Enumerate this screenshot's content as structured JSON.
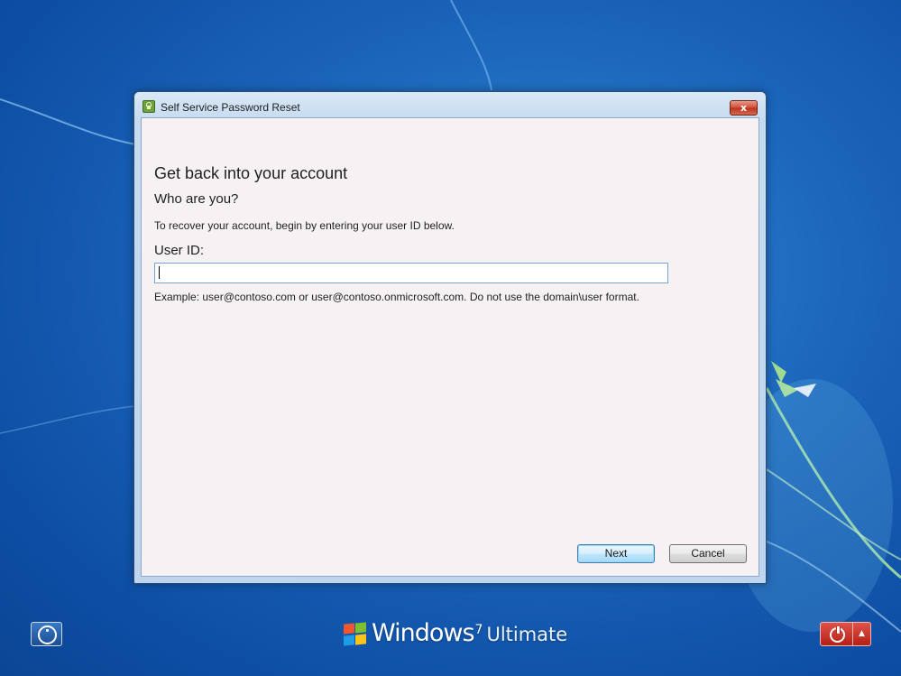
{
  "window": {
    "title": "Self Service Password Reset",
    "close_label": "x"
  },
  "content": {
    "heading": "Get back into your account",
    "subheading": "Who are you?",
    "instruction": "To recover your account, begin by entering your user ID below.",
    "userid_label": "User ID:",
    "userid_value": "",
    "userid_placeholder": "",
    "example": "Example: user@contoso.com or user@contoso.onmicrosoft.com. Do not use the domain\\user format."
  },
  "buttons": {
    "next": "Next",
    "cancel": "Cancel"
  },
  "desktop": {
    "brand_windows": "Windows",
    "brand_version": "7",
    "brand_edition": "Ultimate",
    "ease_access_icon": "ease-of-access-icon",
    "power_icon": "power-icon",
    "power_menu_arrow": "▲"
  },
  "colors": {
    "desktop_blue": "#1a63b9",
    "power_red": "#c3271b",
    "next_accent": "#3c7fb1"
  }
}
